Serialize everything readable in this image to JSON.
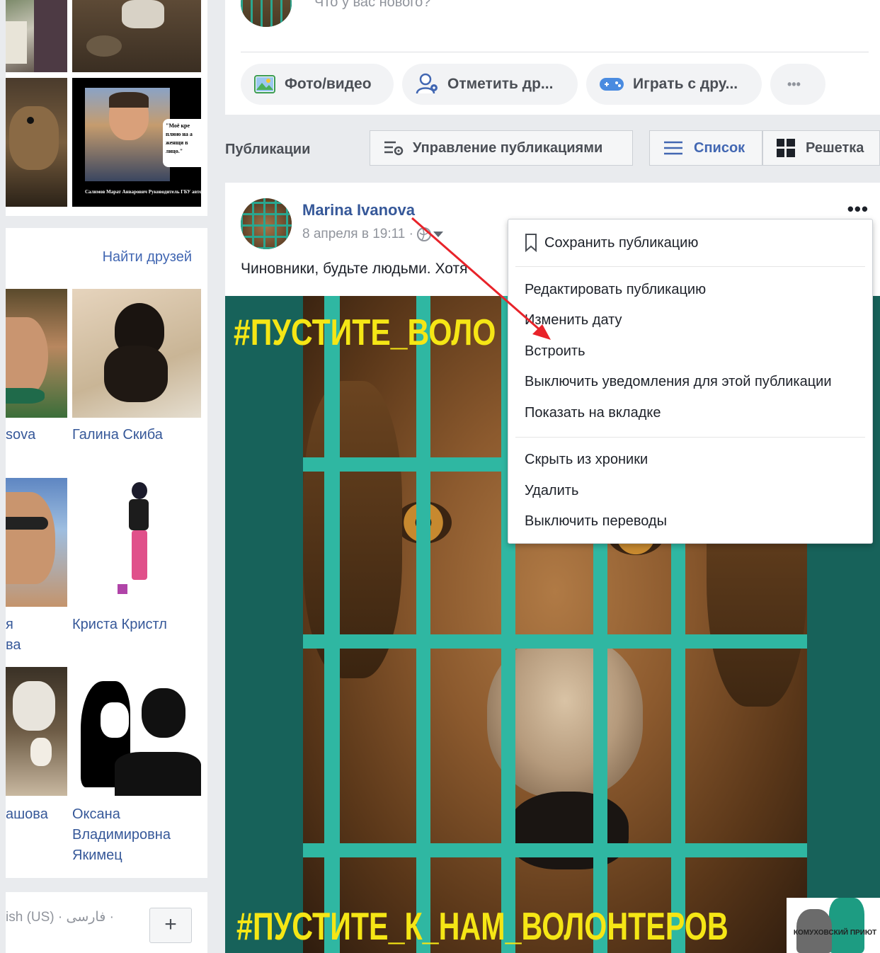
{
  "composer": {
    "placeholder": "Что у вас нового?",
    "buttons": [
      {
        "label": "Фото/видео"
      },
      {
        "label": "Отметить др..."
      },
      {
        "label": "Играть с дру..."
      },
      {
        "label": "•••"
      }
    ]
  },
  "publications": {
    "label": "Публикации",
    "manage_label": "Управление публикациями",
    "list_label": "Список",
    "grid_label": "Решетка"
  },
  "photo_caption": {
    "quote": "\"Моё кре плюю на а женщи в лицо.\"",
    "footer": "Салимов Марат Анварович Руководитель ГБУ автомобильных дор"
  },
  "friends": {
    "find_label": "Найти друзей",
    "names": [
      {
        "name": "sova"
      },
      {
        "name": "Галина Скиба"
      },
      {
        "name": "я\nва"
      },
      {
        "name": "Криста Кристл"
      },
      {
        "name": "ашова"
      },
      {
        "name": "Оксана\nВладимировна\nЯкимец"
      }
    ]
  },
  "footer": {
    "languages": "ish (US) · فارسی ·",
    "plus_label": "+"
  },
  "post": {
    "author": "Marina Ivanova",
    "date": "8 апреля в 19:11 ·",
    "text": "Чиновники, будьте людьми. Хотя",
    "more_label": "•••",
    "image_top_text": "#ПУСТИТЕ_ВОЛО",
    "image_bottom_text": "#ПУСТИТЕ_К_НАМ_ВОЛОНТЕРОВ",
    "logo_text": "КОМУХОВСКИЙ ПРИЮТ"
  },
  "menu": {
    "items": [
      {
        "label": "Сохранить публикацию"
      },
      {
        "label": "Редактировать публикацию"
      },
      {
        "label": "Изменить дату"
      },
      {
        "label": "Встроить"
      },
      {
        "label": "Выключить уведомления для этой публикации"
      },
      {
        "label": "Показать на вкладке"
      },
      {
        "label": "Скрыть из хроники"
      },
      {
        "label": "Удалить"
      },
      {
        "label": "Выключить переводы"
      }
    ]
  },
  "colors": {
    "link": "#365899",
    "accent": "#4267b2",
    "hashtag": "#f5e615",
    "bars": "#2fb7a2",
    "arrow": "#e8232a"
  }
}
